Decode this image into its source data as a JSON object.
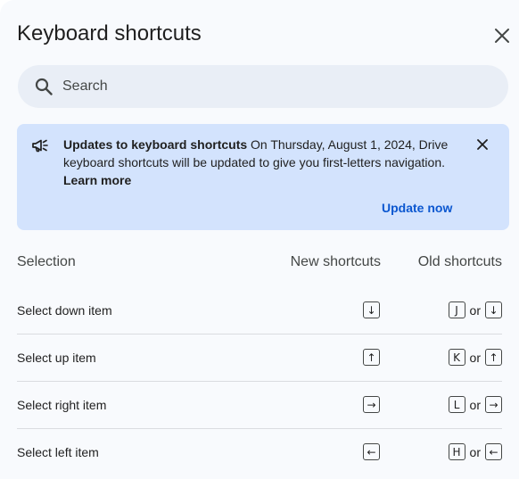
{
  "dialog": {
    "title": "Keyboard shortcuts",
    "close_icon": "close-icon"
  },
  "search": {
    "placeholder": "Search",
    "value": "",
    "icon": "search-icon"
  },
  "banner": {
    "icon": "megaphone-icon",
    "heading": "Updates to keyboard shortcuts",
    "body": " On Thursday, August 1, 2024, Drive keyboard shortcuts will be updated to give you first-letters navigation. ",
    "link": "Learn more",
    "action": "Update now",
    "dismiss_icon": "close-icon"
  },
  "table": {
    "headers": {
      "selection": "Selection",
      "new": "New shortcuts",
      "old": "Old shortcuts"
    },
    "or_text": "or",
    "rows": [
      {
        "label": "Select down item",
        "new_key": "↓",
        "old_key_a": "J",
        "old_key_b": "↓"
      },
      {
        "label": "Select up item",
        "new_key": "↑",
        "old_key_a": "K",
        "old_key_b": "↑"
      },
      {
        "label": "Select right item",
        "new_key": "→",
        "old_key_a": "L",
        "old_key_b": "→"
      },
      {
        "label": "Select left item",
        "new_key": "←",
        "old_key_a": "H",
        "old_key_b": "←"
      }
    ]
  },
  "colors": {
    "background": "#f8fafd",
    "search_bg": "#e9eef6",
    "banner_bg": "#d3e3fd",
    "link_blue": "#0b57d0",
    "divider": "#dadce0"
  }
}
